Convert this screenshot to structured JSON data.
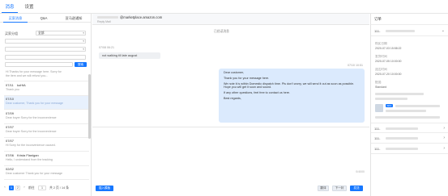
{
  "top_tabs": [
    "消息",
    "设置"
  ],
  "left": {
    "subtabs": [
      "买家消息",
      "Q&A",
      "亚马逊通知"
    ],
    "filter": {
      "label": "买家分组",
      "select_value": "全部",
      "site_value": "",
      "site_caret": "",
      "search_label": "搜索"
    },
    "messages": [
      {
        "date": "",
        "name": "",
        "preview": "Hi Thanks for your message here. Sorry for"
      },
      {
        "date": "",
        "name": "",
        "preview": "the item and we will refund you..."
      },
      {
        "date": "07/11",
        "name": "koHiA",
        "preview": "Thank you"
      },
      {
        "date": "07/10",
        "name": "",
        "preview": "Dear customer, Thank you for your message"
      },
      {
        "date": "07/09",
        "name": "",
        "preview": "Dear buyer Sorry for the inconvenience"
      },
      {
        "date": "07/07",
        "name": "",
        "preview": "Dear buyer Sorry for the inconvenience"
      },
      {
        "date": "07/07",
        "name": "",
        "preview": "Hi Sorry for the inconvenience caused."
      },
      {
        "date": "07/06",
        "name": "Krista Flanigan",
        "preview": "Hello, I understand from the tracking"
      },
      {
        "date": "02/02",
        "name": "",
        "preview": "Dear customer Thank you for your message"
      }
    ],
    "pager": {
      "prev": "‹",
      "page_1": "1",
      "page_2": "2",
      "next": "›",
      "goto_label": "前往",
      "goto_value": "1",
      "total_text": "共 2 页 / 14 条"
    }
  },
  "chat": {
    "email": "@marketplace.amazon.com",
    "reply_label": "Reply Mail",
    "center_note": "已经读消息",
    "time_left": "07/08 06:21",
    "message_in": "not walking till late august",
    "time_right": "07/10 10:51",
    "reply_lines": [
      "Dear customer,",
      "Thank you for your message here.",
      "We note it is within Domestic dispatch time. Pls don't worry, we will send it out as soon as possible. Hope you will get it soon and sound.",
      "If any other questions, feel free to contact us here.",
      "Best regards,"
    ],
    "counter": "0/4000",
    "btn_template": "插入模板",
    "btn_translate": "翻译",
    "btn_next": "下一封",
    "btn_send": "发送"
  },
  "right": {
    "title": "订单",
    "orders": [
      {
        "id": "111-",
        "open": true
      },
      {
        "id": "111-",
        "open": false
      },
      {
        "id": "111-",
        "open": false
      },
      {
        "id": "111-",
        "open": false
      }
    ],
    "fields": [
      {
        "label": "购买日期",
        "value": "2020-07-03 15:58:22"
      },
      {
        "label": "发货时间",
        "value": "2020-07-05 10:00:00"
      },
      {
        "label": "送达时间",
        "value": "2020-07-20 10:00:00"
      },
      {
        "label": "配送:",
        "value": "Standard"
      }
    ],
    "tag_text": "SKU"
  },
  "colors": {
    "accent": "#1677ff",
    "selected_bg": "#e8f1fd",
    "bubble_right": "#dbeafd",
    "bubble_left": "#eef0f3"
  }
}
